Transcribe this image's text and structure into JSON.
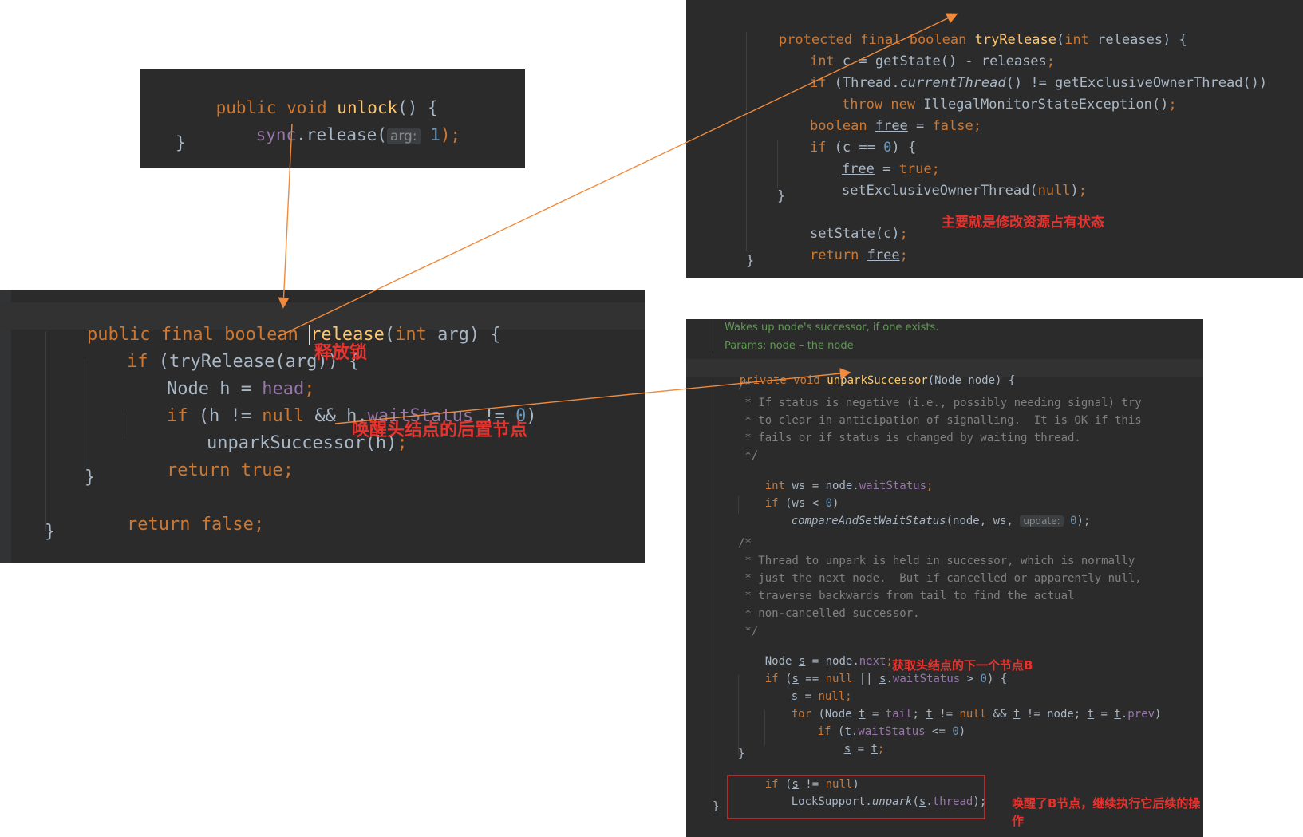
{
  "unlock": {
    "l1": {
      "kw": "public void ",
      "name": "unlock",
      "rest": "() {"
    },
    "l2": {
      "obj": "sync",
      "call": ".release(",
      "hint": "arg:",
      "num": "1",
      "end": ");"
    },
    "l3": "}"
  },
  "release": {
    "l1": {
      "kw": "public final boolean ",
      "name": "release",
      "a": "(",
      "kw2": "int",
      "b": " arg) {"
    },
    "l2": {
      "kw": "if",
      "b": " (tryRelease(arg)) {"
    },
    "l3": {
      "a": "Node h = ",
      "field": "head",
      "end": ";"
    },
    "l4": {
      "kw": "if",
      "a": " (h != ",
      "kw2": "null",
      "b": " && h.",
      "field": "waitStatus",
      "c": " != ",
      "num": "0",
      "d": ")"
    },
    "l5": {
      "a": "unparkSuccessor(h)",
      "end": ";"
    },
    "l6": {
      "kw": "return true",
      "end": ";"
    },
    "l7": "}",
    "l8": {
      "kw": "return false",
      "end": ";"
    },
    "l9": "}"
  },
  "tryrelease": {
    "l1": {
      "kw": "protected final boolean ",
      "name": "tryRelease",
      "a": "(",
      "kw2": "int",
      "b": " releases) {"
    },
    "l2": {
      "kw": "int",
      "a": " c = getState() - releases",
      "end": ";"
    },
    "l3": {
      "kw": "if",
      "a": " (Thread.",
      "it": "currentThread",
      "b": "() != getExclusiveOwnerThread())"
    },
    "l4": {
      "kw": "throw new ",
      "a": "IllegalMonitorStateException()",
      "end": ";"
    },
    "l5": {
      "kw": "boolean ",
      "var": "free",
      "a": " = ",
      "kw2": "false",
      "end": ";"
    },
    "l6": {
      "kw": "if",
      "a": " (c == ",
      "num": "0",
      "b": ") {"
    },
    "l7": {
      "var": "free",
      "a": " = ",
      "kw": "true",
      "end": ";"
    },
    "l8": {
      "a": "setExclusiveOwnerThread(",
      "kw": "null",
      "b": ")",
      "end": ";"
    },
    "l9": "}",
    "l10": {
      "a": "setState(c)",
      "end": ";"
    },
    "l11": {
      "kw": "return ",
      "var": "free",
      "end": ";"
    },
    "l12": "}"
  },
  "unpark": {
    "doc1": "Wakes up node's successor, if one exists.",
    "doc2": "Params: node – the node",
    "sig": {
      "kw": "private void ",
      "name": "unparkSuccessor",
      "rest": "(Node node) {"
    },
    "c1": [
      "/*",
      " * If status is negative (i.e., possibly needing signal) try",
      " * to clear in anticipation of signalling.  It is OK if this",
      " * fails or if status is changed by waiting thread.",
      " */"
    ],
    "s1": {
      "kw": "int",
      "a": " ws = node.",
      "field": "waitStatus",
      "end": ";"
    },
    "s2": {
      "kw": "if",
      "a": " (ws < ",
      "num": "0",
      "b": ")"
    },
    "s3": {
      "it": "compareAndSetWaitStatus",
      "a": "(node, ws, ",
      "hint": "update:",
      "num": "0",
      "b": ");"
    },
    "c2": [
      "/*",
      " * Thread to unpark is held in successor, which is normally",
      " * just the next node.  But if cancelled or apparently null,",
      " * traverse backwards from tail to find the actual",
      " * non-cancelled successor.",
      " */"
    ],
    "s4": {
      "a": "Node ",
      "var": "s",
      "b": " = node.",
      "field": "next",
      "end": ";"
    },
    "s5": {
      "kw": "if",
      "a": " (",
      "var": "s",
      "b": " == ",
      "kw2": "null",
      "c": " || ",
      "var2": "s",
      "d": ".",
      "field": "waitStatus",
      "e": " > ",
      "num": "0",
      "f": ") {"
    },
    "s6": {
      "var": "s",
      "a": " = ",
      "kw": "null",
      "end": ";"
    },
    "s7": {
      "kw": "for",
      "a": " (Node ",
      "t1": "t",
      "b": " = ",
      "field": "tail",
      "c": "; ",
      "t2": "t",
      "d": " != ",
      "kw2": "null",
      "e": " && ",
      "t3": "t",
      "f": " != node; ",
      "t4": "t",
      "g": " = ",
      "t5": "t",
      "h": ".",
      "field2": "prev",
      "i": ")"
    },
    "s8": {
      "kw": "if",
      "a": " (",
      "t": "t",
      "b": ".",
      "field": "waitStatus",
      "c": " <= ",
      "num": "0",
      "d": ")"
    },
    "s9": {
      "s": "s",
      "a": " = ",
      "t": "t",
      "end": ";"
    },
    "s10": "}",
    "s11": {
      "kw": "if",
      "a": " (",
      "s": "s",
      "b": " != ",
      "kw2": "null",
      "c": ")"
    },
    "s12": {
      "a": "LockSupport.",
      "it": "unpark",
      "b": "(",
      "s": "s",
      "c": ".",
      "field": "thread",
      "d": ");"
    },
    "s13": "}"
  },
  "notes": {
    "release_lock": "释放锁",
    "wake_head": "唤醒头结点的后置节点",
    "modify_state": "主要就是修改资源占有状态",
    "get_next": "获取头结点的下一个节点B",
    "wake_b": "唤醒了B节点，继续执行它后续的操作"
  },
  "colors": {
    "arrow": "#f08a3c",
    "note": "#e8322d",
    "highlight_box": "#e03030"
  }
}
